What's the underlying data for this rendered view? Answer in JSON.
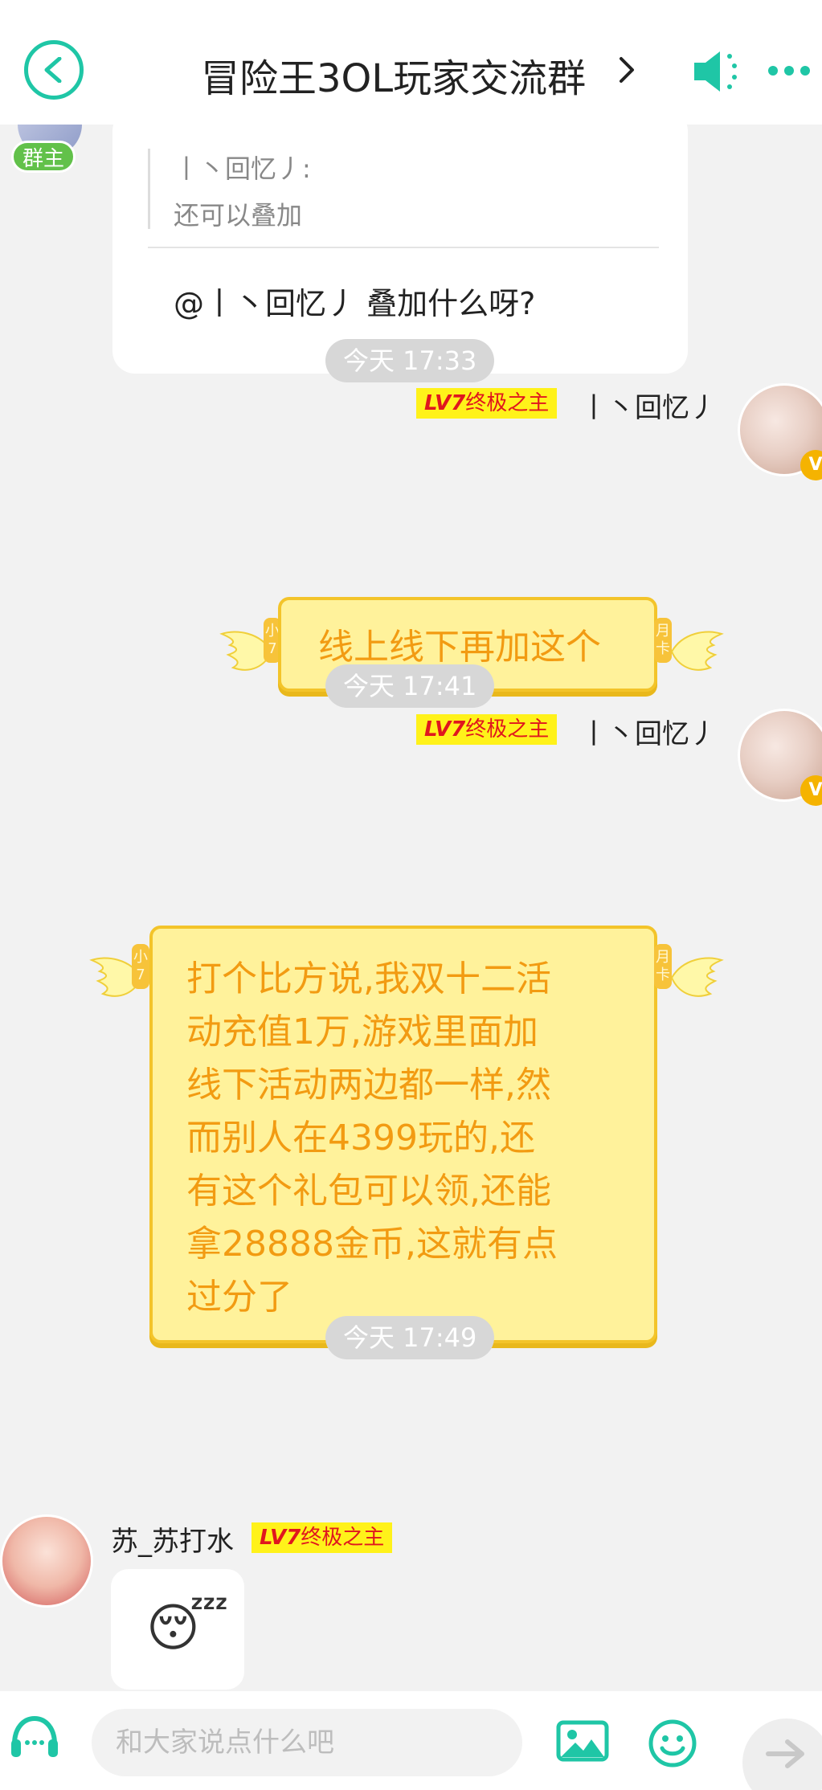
{
  "header": {
    "title": "冒险王3OL玩家交流群",
    "accent_color": "#1fc6a6"
  },
  "chat": {
    "owner_badge": "群主",
    "reply_card": {
      "quote_name": "丨丶回忆丿:",
      "quote_text": "还可以叠加",
      "reply_text": "@丨丶回忆丿 叠加什么呀?"
    },
    "messages": [
      {
        "time": "今天 17:33",
        "level_prefix": "LV7",
        "level_title": "终极之主",
        "sender": "丨丶回忆丿",
        "tag_left": "小7",
        "tag_right": "月卡",
        "lines": [
          "线上线下再加这个"
        ]
      },
      {
        "time": "今天 17:41",
        "level_prefix": "LV7",
        "level_title": "终极之主",
        "sender": "丨丶回忆丿",
        "tag_left": "小7",
        "tag_right": "月卡",
        "lines": [
          "打个比方说,我双十二活",
          "动充值1万,游戏里面加",
          "线下活动两边都一样,然",
          "而别人在4399玩的,还",
          "有这个礼包可以领,还能",
          "拿28888金币,这就有点",
          "过分了"
        ]
      },
      {
        "time": "今天 17:49",
        "sender": "苏_苏打水",
        "level_prefix": "LV7",
        "level_title": "终极之主",
        "emoji": "😴"
      }
    ]
  },
  "input_bar": {
    "placeholder": "和大家说点什么吧",
    "icons": [
      "headset-icon",
      "image-icon",
      "emoji-icon",
      "send-arrow-icon"
    ]
  }
}
